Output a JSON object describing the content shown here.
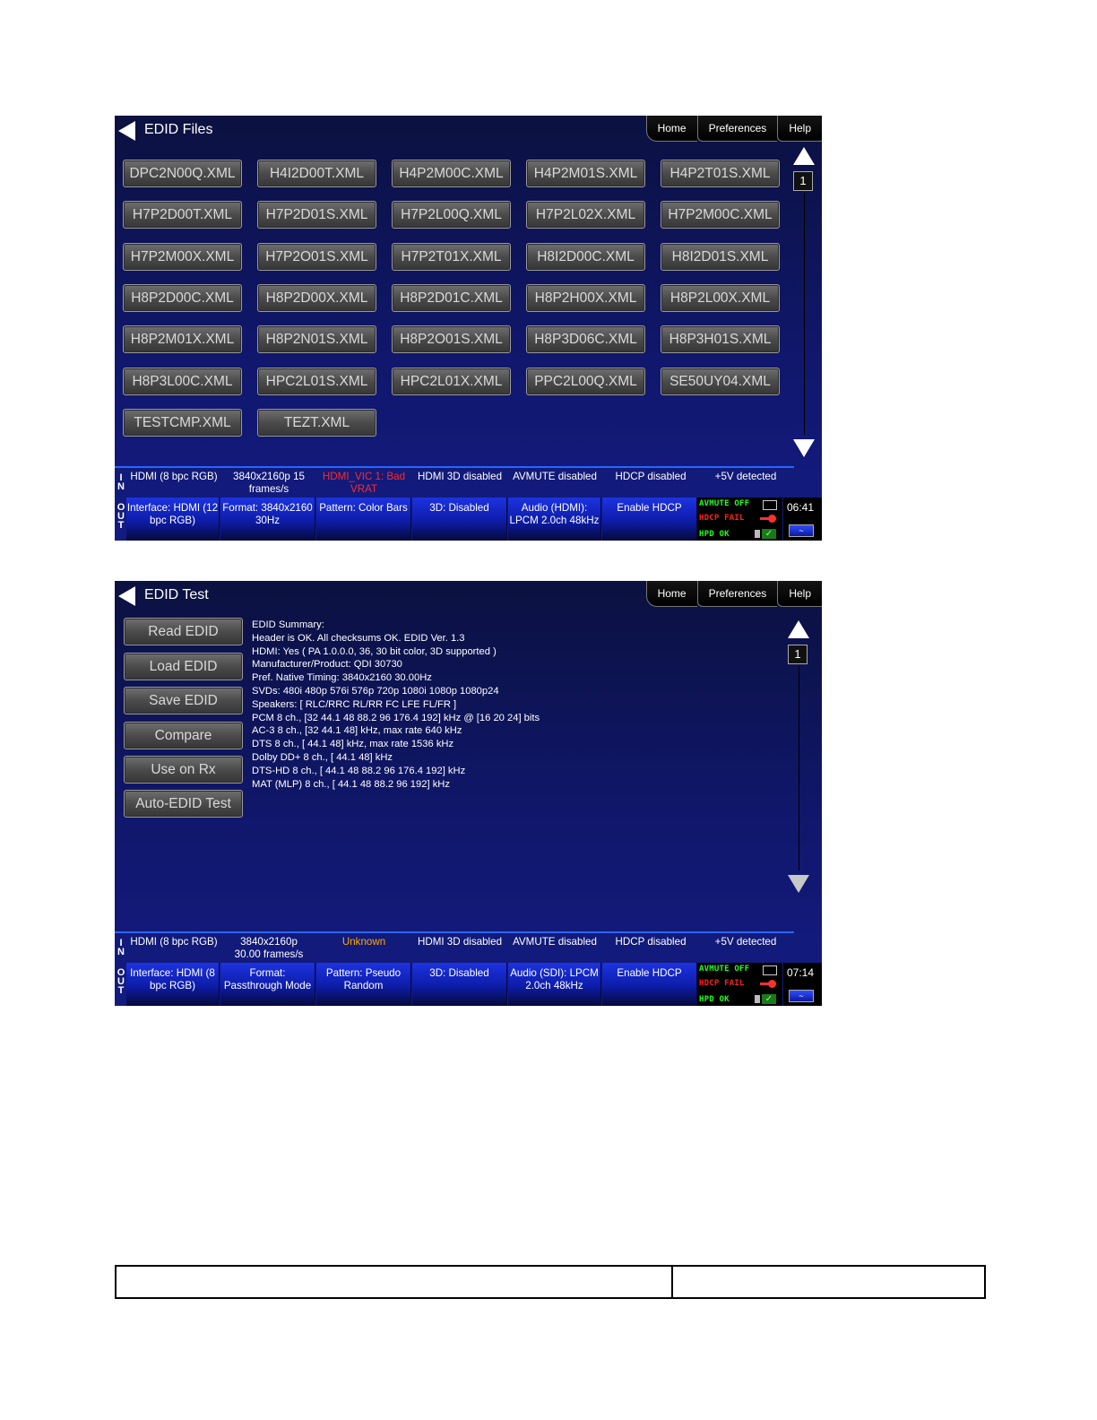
{
  "nav": {
    "home": "Home",
    "preferences": "Preferences",
    "help": "Help"
  },
  "screen1": {
    "title": "EDID Files",
    "page": "1",
    "files": [
      "DPC2N00Q.XML",
      "H4I2D00T.XML",
      "H4P2M00C.XML",
      "H4P2M01S.XML",
      "H4P2T01S.XML",
      "H7P2D00T.XML",
      "H7P2D01S.XML",
      "H7P2L00Q.XML",
      "H7P2L02X.XML",
      "H7P2M00C.XML",
      "H7P2M00X.XML",
      "H7P2O01S.XML",
      "H7P2T01X.XML",
      "H8I2D00C.XML",
      "H8I2D01S.XML",
      "H8P2D00C.XML",
      "H8P2D00X.XML",
      "H8P2D01C.XML",
      "H8P2H00X.XML",
      "H8P2L00X.XML",
      "H8P2M01X.XML",
      "H8P2N01S.XML",
      "H8P2O01S.XML",
      "H8P3D06C.XML",
      "H8P3H01S.XML",
      "H8P3L00C.XML",
      "HPC2L01S.XML",
      "HPC2L01X.XML",
      "PPC2L00Q.XML",
      "SE50UY04.XML",
      "TESTCMP.XML",
      "TEZT.XML"
    ],
    "in_row": {
      "label": "I N",
      "interface": "HDMI (8 bpc RGB)",
      "format": "3840x2160p 15 frames/s",
      "vic": "HDMI_VIC 1: Bad VRAT",
      "three_d": "HDMI 3D disabled",
      "avmute": "AVMUTE disabled",
      "hdcp": "HDCP disabled",
      "power": "+5V detected"
    },
    "out_row": {
      "label": "O U T",
      "interface": "Interface: HDMI (12 bpc RGB)",
      "format": "Format: 3840x2160 30Hz",
      "pattern": "Pattern: Color Bars",
      "three_d": "3D: Disabled",
      "audio": "Audio (HDMI): LPCM 2.0ch 48kHz",
      "hdcp": "Enable HDCP"
    },
    "status": {
      "avmute": "AVMUTE OFF",
      "hdcp": "HDCP FAIL",
      "hpd": "HPD OK"
    },
    "time": "06:41"
  },
  "screen2": {
    "title": "EDID Test",
    "page": "1",
    "buttons": [
      "Read EDID",
      "Load EDID",
      "Save EDID",
      "Compare",
      "Use on Rx",
      "Auto-EDID Test"
    ],
    "summary": [
      "EDID Summary:",
      "Header is OK. All checksums OK. EDID Ver. 1.3",
      "HDMI: Yes ( PA 1.0.0.0, 36, 30 bit color, 3D supported )",
      "Manufacturer/Product: QDI 30730",
      "Pref. Native Timing: 3840x2160 30.00Hz",
      "SVDs: 480i 480p 576i 576p 720p 1080i 1080p 1080p24",
      "Speakers: [ RLC/RRC RL/RR FC LFE FL/FR ]",
      "PCM 8 ch., [32 44.1 48 88.2 96 176.4 192] kHz @ [16 20 24] bits",
      "AC-3 8 ch., [32 44.1 48] kHz, max rate 640 kHz",
      "DTS 8 ch., [ 44.1 48] kHz, max rate 1536 kHz",
      "Dolby DD+ 8 ch., [ 44.1 48] kHz",
      "DTS-HD 8 ch., [ 44.1 48 88.2 96 176.4 192] kHz",
      "MAT (MLP) 8 ch., [ 44.1 48 88.2 96 192] kHz"
    ],
    "in_row": {
      "label": "I N",
      "interface": "HDMI (8 bpc RGB)",
      "format": "3840x2160p 30.00 frames/s",
      "vic": "Unknown",
      "three_d": "HDMI 3D disabled",
      "avmute": "AVMUTE disabled",
      "hdcp": "HDCP disabled",
      "power": "+5V detected"
    },
    "out_row": {
      "label": "O U T",
      "interface": "Interface: HDMI (8 bpc RGB)",
      "format": "Format: Passthrough Mode",
      "pattern": "Pattern: Pseudo Random",
      "three_d": "3D: Disabled",
      "audio": "Audio (SDI): LPCM 2.0ch 48kHz",
      "hdcp": "Enable HDCP"
    },
    "status": {
      "avmute": "AVMUTE OFF",
      "hdcp": "HDCP FAIL",
      "hpd": "HPD OK"
    },
    "time": "07:14"
  },
  "icons": {
    "back": "back-arrow-icon",
    "scroll_up": "scroll-up-icon",
    "scroll_down": "scroll-down-icon",
    "monitor": "monitor-icon",
    "key": "key-icon",
    "check": "check-icon",
    "signal": "signal-icon"
  }
}
